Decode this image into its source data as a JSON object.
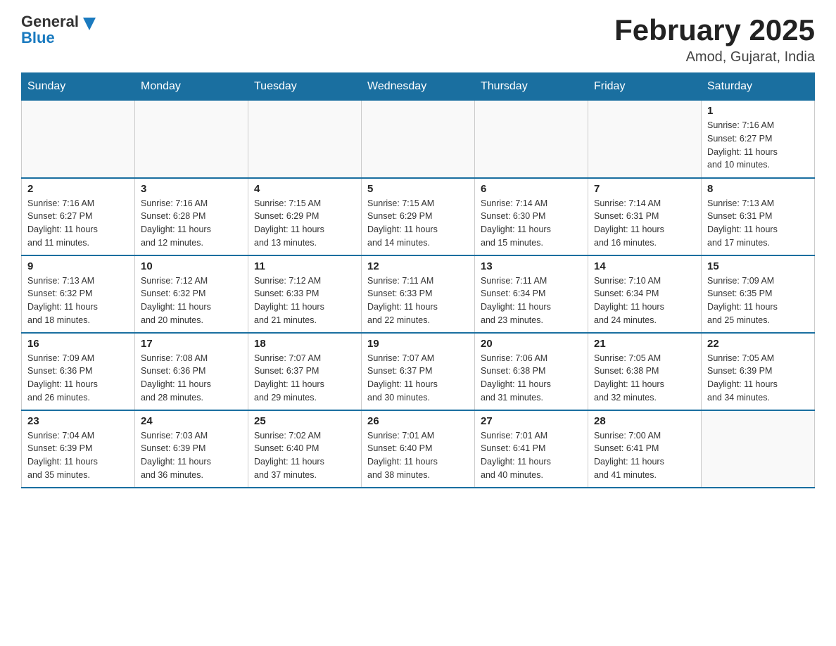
{
  "header": {
    "logo_general": "General",
    "logo_blue": "Blue",
    "title": "February 2025",
    "subtitle": "Amod, Gujarat, India"
  },
  "weekdays": [
    "Sunday",
    "Monday",
    "Tuesday",
    "Wednesday",
    "Thursday",
    "Friday",
    "Saturday"
  ],
  "weeks": [
    [
      {
        "day": "",
        "info": ""
      },
      {
        "day": "",
        "info": ""
      },
      {
        "day": "",
        "info": ""
      },
      {
        "day": "",
        "info": ""
      },
      {
        "day": "",
        "info": ""
      },
      {
        "day": "",
        "info": ""
      },
      {
        "day": "1",
        "info": "Sunrise: 7:16 AM\nSunset: 6:27 PM\nDaylight: 11 hours\nand 10 minutes."
      }
    ],
    [
      {
        "day": "2",
        "info": "Sunrise: 7:16 AM\nSunset: 6:27 PM\nDaylight: 11 hours\nand 11 minutes."
      },
      {
        "day": "3",
        "info": "Sunrise: 7:16 AM\nSunset: 6:28 PM\nDaylight: 11 hours\nand 12 minutes."
      },
      {
        "day": "4",
        "info": "Sunrise: 7:15 AM\nSunset: 6:29 PM\nDaylight: 11 hours\nand 13 minutes."
      },
      {
        "day": "5",
        "info": "Sunrise: 7:15 AM\nSunset: 6:29 PM\nDaylight: 11 hours\nand 14 minutes."
      },
      {
        "day": "6",
        "info": "Sunrise: 7:14 AM\nSunset: 6:30 PM\nDaylight: 11 hours\nand 15 minutes."
      },
      {
        "day": "7",
        "info": "Sunrise: 7:14 AM\nSunset: 6:31 PM\nDaylight: 11 hours\nand 16 minutes."
      },
      {
        "day": "8",
        "info": "Sunrise: 7:13 AM\nSunset: 6:31 PM\nDaylight: 11 hours\nand 17 minutes."
      }
    ],
    [
      {
        "day": "9",
        "info": "Sunrise: 7:13 AM\nSunset: 6:32 PM\nDaylight: 11 hours\nand 18 minutes."
      },
      {
        "day": "10",
        "info": "Sunrise: 7:12 AM\nSunset: 6:32 PM\nDaylight: 11 hours\nand 20 minutes."
      },
      {
        "day": "11",
        "info": "Sunrise: 7:12 AM\nSunset: 6:33 PM\nDaylight: 11 hours\nand 21 minutes."
      },
      {
        "day": "12",
        "info": "Sunrise: 7:11 AM\nSunset: 6:33 PM\nDaylight: 11 hours\nand 22 minutes."
      },
      {
        "day": "13",
        "info": "Sunrise: 7:11 AM\nSunset: 6:34 PM\nDaylight: 11 hours\nand 23 minutes."
      },
      {
        "day": "14",
        "info": "Sunrise: 7:10 AM\nSunset: 6:34 PM\nDaylight: 11 hours\nand 24 minutes."
      },
      {
        "day": "15",
        "info": "Sunrise: 7:09 AM\nSunset: 6:35 PM\nDaylight: 11 hours\nand 25 minutes."
      }
    ],
    [
      {
        "day": "16",
        "info": "Sunrise: 7:09 AM\nSunset: 6:36 PM\nDaylight: 11 hours\nand 26 minutes."
      },
      {
        "day": "17",
        "info": "Sunrise: 7:08 AM\nSunset: 6:36 PM\nDaylight: 11 hours\nand 28 minutes."
      },
      {
        "day": "18",
        "info": "Sunrise: 7:07 AM\nSunset: 6:37 PM\nDaylight: 11 hours\nand 29 minutes."
      },
      {
        "day": "19",
        "info": "Sunrise: 7:07 AM\nSunset: 6:37 PM\nDaylight: 11 hours\nand 30 minutes."
      },
      {
        "day": "20",
        "info": "Sunrise: 7:06 AM\nSunset: 6:38 PM\nDaylight: 11 hours\nand 31 minutes."
      },
      {
        "day": "21",
        "info": "Sunrise: 7:05 AM\nSunset: 6:38 PM\nDaylight: 11 hours\nand 32 minutes."
      },
      {
        "day": "22",
        "info": "Sunrise: 7:05 AM\nSunset: 6:39 PM\nDaylight: 11 hours\nand 34 minutes."
      }
    ],
    [
      {
        "day": "23",
        "info": "Sunrise: 7:04 AM\nSunset: 6:39 PM\nDaylight: 11 hours\nand 35 minutes."
      },
      {
        "day": "24",
        "info": "Sunrise: 7:03 AM\nSunset: 6:39 PM\nDaylight: 11 hours\nand 36 minutes."
      },
      {
        "day": "25",
        "info": "Sunrise: 7:02 AM\nSunset: 6:40 PM\nDaylight: 11 hours\nand 37 minutes."
      },
      {
        "day": "26",
        "info": "Sunrise: 7:01 AM\nSunset: 6:40 PM\nDaylight: 11 hours\nand 38 minutes."
      },
      {
        "day": "27",
        "info": "Sunrise: 7:01 AM\nSunset: 6:41 PM\nDaylight: 11 hours\nand 40 minutes."
      },
      {
        "day": "28",
        "info": "Sunrise: 7:00 AM\nSunset: 6:41 PM\nDaylight: 11 hours\nand 41 minutes."
      },
      {
        "day": "",
        "info": ""
      }
    ]
  ]
}
